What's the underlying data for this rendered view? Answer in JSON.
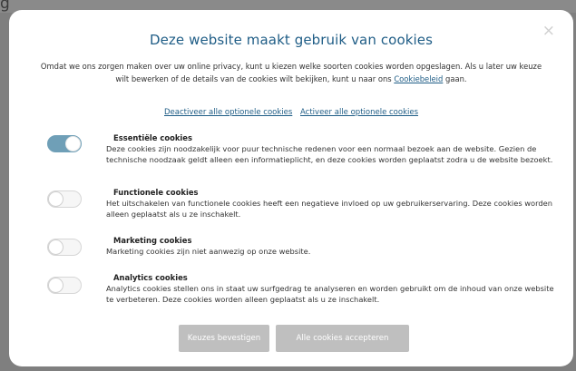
{
  "background": {
    "heading_fragment": "g"
  },
  "modal": {
    "close_glyph": "×",
    "title": "Deze website maakt gebruik van cookies",
    "intro_text": "Omdat we ons zorgen maken over uw online privacy, kunt u kiezen welke soorten cookies worden opgeslagen. Als u later uw keuze wilt bewerken of de details van de cookies wilt bekijken, kunt u naar ons ",
    "intro_link": "Cookiebeleid",
    "intro_suffix": " gaan.",
    "deactivate_link": "Deactiveer alle optionele cookies",
    "activate_link": "Activeer alle optionele cookies",
    "categories": [
      {
        "title": "Essentiële cookies",
        "description": "Deze cookies zijn noodzakelijk voor puur technische redenen voor een normaal bezoek aan de website. Gezien de technische noodzaak geldt alleen een informatieplicht, en deze cookies worden geplaatst zodra u de website bezoekt.",
        "enabled": true
      },
      {
        "title": "Functionele cookies",
        "description": "Het uitschakelen van functionele cookies heeft een negatieve invloed op uw gebruikerservaring. Deze cookies worden alleen geplaatst als u ze inschakelt.",
        "enabled": false
      },
      {
        "title": "Marketing cookies",
        "description": "Marketing cookies zijn niet aanwezig op onze website.",
        "enabled": false
      },
      {
        "title": "Analytics cookies",
        "description": "Analytics cookies stellen ons in staat uw surfgedrag te analyseren en worden gebruikt om de inhoud van onze website te verbeteren. Deze cookies worden alleen geplaatst als u ze inschakelt.",
        "enabled": false
      }
    ],
    "confirm_button": "Keuzes bevestigen",
    "accept_all_button": "Alle cookies accepteren"
  },
  "colors": {
    "accent": "#1f5d86",
    "toggle_on": "#6f9fb7",
    "button": "#bfbfbf"
  }
}
